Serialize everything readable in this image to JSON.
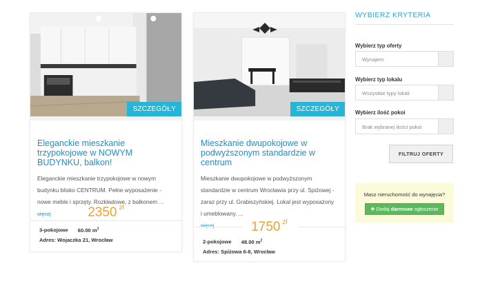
{
  "listings": [
    {
      "details_label": "SZCZEGÓŁY",
      "title": "Eleganckie mieszkanie trzypokojowe w NOWYM BUDYNKU, balkon!",
      "description": "Eleganckie mieszkanie trzypokojowe w nowym budynku blisko CENTRUM. Pełne wyposażenie - nowe meble i sprzęty. Rozkładowe, z balkonem ...",
      "more_label": "więcej",
      "price": "2350",
      "currency": "zł",
      "rooms": "3-pokojowe",
      "area": "60.00 m",
      "area_sup": "2",
      "address": "Adres: Wojaczka 21, Wrocław"
    },
    {
      "details_label": "SZCZEGÓŁY",
      "title": "Mieszkanie dwupokojowe w podwyższonym standardzie w centrum",
      "description": "Mieszkanie dwupokojowe w podwyższonym standardzie w centrum Wrocławia przy ul. Spiżowej - zaraz przy ul. Grabiszyńskiej. Lokal jest wyposażony i umeblowany. ...",
      "more_label": "więcej",
      "price": "1750",
      "currency": "zł",
      "rooms": "2-pokojowe",
      "area": "48.00 m",
      "area_sup": "2",
      "address": "Adres: Spiżowa 6-8, Wrocław"
    }
  ],
  "sidebar": {
    "title": "WYBIERZ KRYTERIA",
    "offer_type_label": "Wybierz typ oferty",
    "offer_type_value": "Wynajem",
    "unit_type_label": "Wybierz typ lokalu",
    "unit_type_value": "Wszystkie typy lokali",
    "rooms_label": "Wybierz ilość pokoi",
    "rooms_value": "Brak wybranej ilości pokoi",
    "filter_button": "FILTRUJ OFERTY"
  },
  "promo": {
    "question": "Masz nieruchomość do wynajęcia?",
    "button_prefix": "Dodaj",
    "button_bold": "darmowe",
    "button_suffix": "ogłoszenie"
  },
  "colors": {
    "accent": "#26b5d7",
    "link": "#1a8fcf",
    "price": "#f0a12c",
    "promo_bg": "#fcfbd9",
    "add_button": "#5cb85c"
  }
}
